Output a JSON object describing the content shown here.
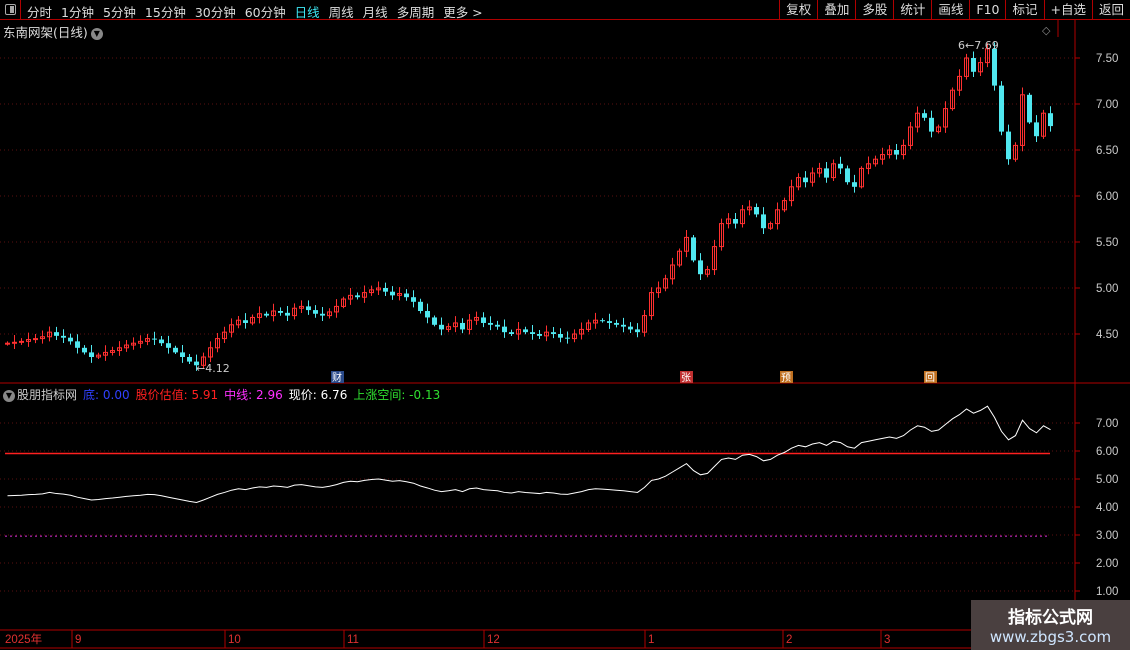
{
  "toolbar": {
    "periods": [
      "分时",
      "1分钟",
      "5分钟",
      "15分钟",
      "30分钟",
      "60分钟",
      "日线",
      "周线",
      "月线",
      "多周期",
      "更多 >"
    ],
    "active": "日线",
    "right": [
      "复权",
      "叠加",
      "多股",
      "统计",
      "画线",
      "F10",
      "标记",
      "+自选",
      "返回"
    ]
  },
  "stock": {
    "title": "东南网架(日线)"
  },
  "indicator": {
    "name": "股朋指标网",
    "items": [
      {
        "label": "底: 0.00",
        "color": "#3040ff"
      },
      {
        "label": "股价估值: 5.91",
        "color": "#ff2020"
      },
      {
        "label": "中线: 2.96",
        "color": "#ff30ff"
      },
      {
        "label": "现价: 6.76",
        "color": "#ffffff"
      },
      {
        "label": "上涨空间: -0.13",
        "color": "#30e030"
      }
    ]
  },
  "watermark": {
    "title": "指标公式网",
    "url": "www.zbgs3.com"
  },
  "chart_data": {
    "type": "candlestick",
    "price_axis": [
      "7.50",
      "7.00",
      "6.50",
      "6.00",
      "5.50",
      "5.00",
      "4.50"
    ],
    "indicator_axis": [
      "7.00",
      "6.00",
      "5.00",
      "4.00",
      "3.00",
      "2.00",
      "1.00"
    ],
    "x_labels": [
      "2025年",
      "9",
      "10",
      "11",
      "12",
      "1",
      "2",
      "3"
    ],
    "high_label": "7.69",
    "low_label": "4.12",
    "markers": [
      {
        "text": "财",
        "color": "#2a4a8a"
      },
      {
        "text": "张",
        "color": "#c03030"
      },
      {
        "text": "预",
        "color": "#c07020"
      },
      {
        "text": "回",
        "color": "#c07020"
      }
    ],
    "valuation": 5.91,
    "midline": 2.96,
    "closes": [
      4.4,
      4.41,
      4.42,
      4.44,
      4.45,
      4.47,
      4.52,
      4.48,
      4.46,
      4.42,
      4.35,
      4.3,
      4.25,
      4.27,
      4.3,
      4.32,
      4.35,
      4.38,
      4.4,
      4.42,
      4.45,
      4.44,
      4.4,
      4.35,
      4.3,
      4.25,
      4.2,
      4.16,
      4.25,
      4.35,
      4.45,
      4.52,
      4.6,
      4.65,
      4.62,
      4.68,
      4.72,
      4.7,
      4.75,
      4.73,
      4.7,
      4.78,
      4.8,
      4.76,
      4.72,
      4.7,
      4.74,
      4.8,
      4.88,
      4.92,
      4.9,
      4.95,
      4.98,
      5.0,
      4.96,
      4.92,
      4.94,
      4.9,
      4.85,
      4.75,
      4.68,
      4.6,
      4.55,
      4.58,
      4.62,
      4.55,
      4.65,
      4.68,
      4.62,
      4.6,
      4.58,
      4.52,
      4.5,
      4.55,
      4.52,
      4.5,
      4.48,
      4.52,
      4.5,
      4.46,
      4.45,
      4.5,
      4.55,
      4.62,
      4.65,
      4.64,
      4.62,
      4.6,
      4.58,
      4.55,
      4.52,
      4.7,
      4.95,
      5.0,
      5.1,
      5.25,
      5.4,
      5.55,
      5.3,
      5.15,
      5.2,
      5.45,
      5.7,
      5.75,
      5.7,
      5.85,
      5.88,
      5.8,
      5.65,
      5.7,
      5.85,
      5.95,
      6.1,
      6.2,
      6.15,
      6.25,
      6.3,
      6.2,
      6.35,
      6.3,
      6.15,
      6.1,
      6.3,
      6.35,
      6.4,
      6.45,
      6.5,
      6.45,
      6.55,
      6.75,
      6.9,
      6.85,
      6.7,
      6.75,
      6.95,
      7.15,
      7.3,
      7.5,
      7.35,
      7.45,
      7.6,
      7.2,
      6.7,
      6.4,
      6.55,
      7.1,
      6.8,
      6.65,
      6.9,
      6.76
    ]
  }
}
